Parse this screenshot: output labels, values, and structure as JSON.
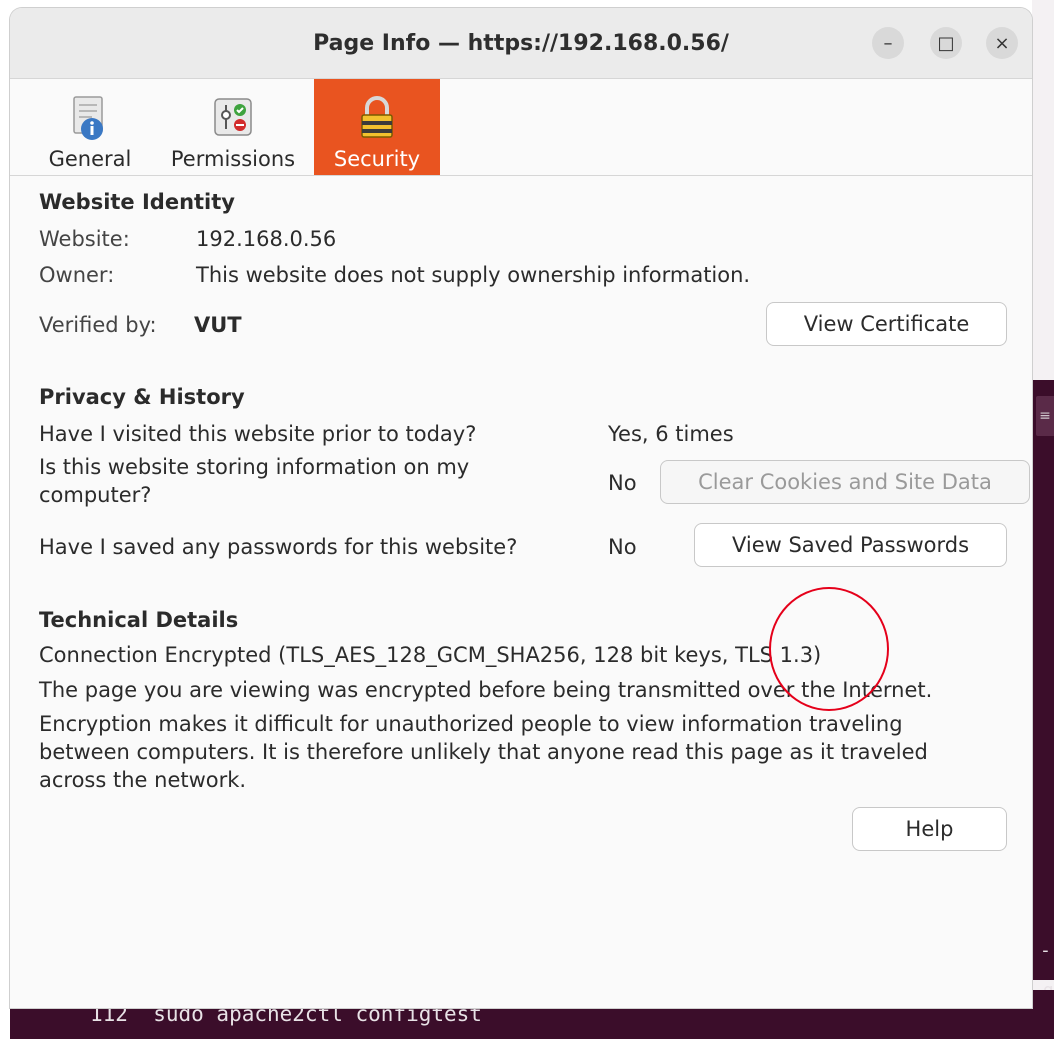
{
  "dialog": {
    "title": "Page Info — https://192.168.0.56/",
    "minimize_glyph": "–",
    "maximize_glyph": "□",
    "close_glyph": "×"
  },
  "tabs": [
    {
      "label": "General",
      "icon": "info-document-icon",
      "active": false
    },
    {
      "label": "Permissions",
      "icon": "permissions-icon",
      "active": false
    },
    {
      "label": "Security",
      "icon": "padlock-icon",
      "active": true
    }
  ],
  "identity": {
    "heading": "Website Identity",
    "website_label": "Website:",
    "website_value": "192.168.0.56",
    "owner_label": "Owner:",
    "owner_value": "This website does not supply ownership information.",
    "verified_label": "Verified by:",
    "verified_value": "VUT",
    "view_certificate": "View Certificate"
  },
  "privacy": {
    "heading": "Privacy & History",
    "q_visited": "Have I visited this website prior to today?",
    "a_visited": "Yes, 6 times",
    "q_storing_line1": "Is this website storing information on my",
    "q_storing_line2": "computer?",
    "a_storing": "No",
    "clear_cookies": "Clear Cookies and Site Data",
    "q_passwords": "Have I saved any passwords for this website?",
    "a_passwords": "No",
    "view_passwords": "View Saved Passwords"
  },
  "technical": {
    "heading": "Technical Details",
    "line1": "Connection Encrypted (TLS_AES_128_GCM_SHA256, 128 bit keys, TLS 1.3)",
    "line2": "The page you are viewing was encrypted before being transmitted over the Internet.",
    "line3a": "Encryption makes it difficult for unauthorized people to view information traveling",
    "line3b": "between computers. It is therefore unlikely that anyone read this page as it traveled",
    "line3c": "across the network."
  },
  "help": "Help",
  "terminal": {
    "line": "112  sudo apache2ctl configtest",
    "side_dash": "-",
    "side_g": ".g"
  },
  "colors": {
    "accent": "#e95420",
    "annotation": "#e5001a",
    "terminal_bg": "#3b0d2a"
  }
}
